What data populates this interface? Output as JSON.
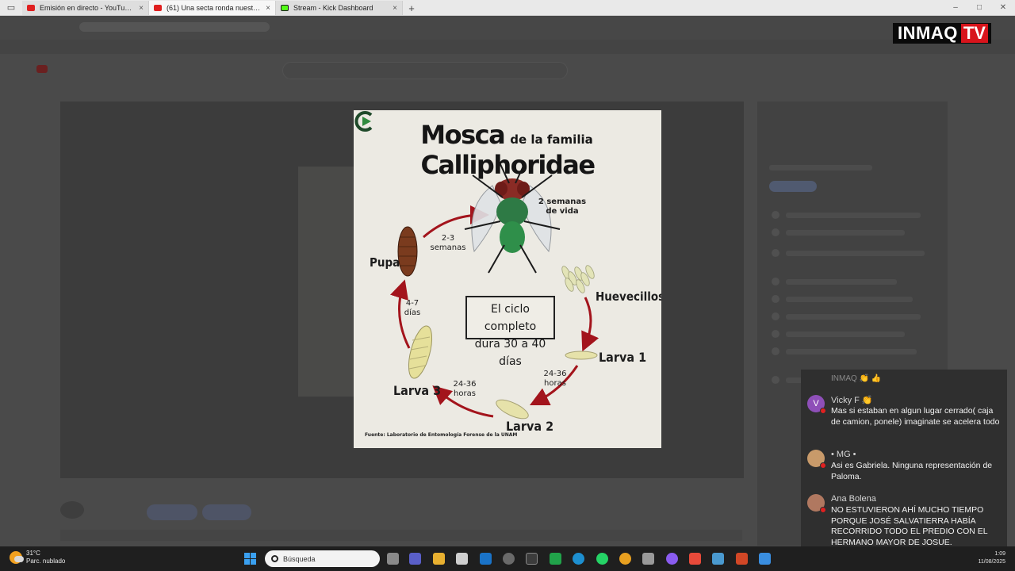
{
  "browser": {
    "tabs": [
      {
        "label": "Emisión en directo - YouTube Stu",
        "favicon": "youtube-icon",
        "active": false
      },
      {
        "label": "(61) Una secta ronda nuestra vida",
        "favicon": "youtube-icon",
        "active": true
      },
      {
        "label": "Stream - Kick Dashboard",
        "favicon": "kick-icon",
        "active": false
      }
    ],
    "new_tab": "+",
    "close_glyph": "×"
  },
  "brand": {
    "part1": "INMAQ",
    "part2": "TV",
    "accent": "#d8141c"
  },
  "infographic": {
    "title_big1": "Mosca",
    "title_small": "de la familia",
    "title_big2": "Calliphoridae",
    "stages": {
      "adult_duration_1": "2 semanas",
      "adult_duration_2": "de vida",
      "eggs": "Huevecillos",
      "larva1": "Larva 1",
      "larva1_to_2_1": "24-36",
      "larva1_to_2_2": "horas",
      "larva2": "Larva 2",
      "larva2_to_3_1": "24-36",
      "larva2_to_3_2": "horas",
      "larva3": "Larva 3",
      "larva3_to_pupa_1": "4-7",
      "larva3_to_pupa_2": "días",
      "pupa": "Pupa",
      "pupa_to_adult_1": "2-3",
      "pupa_to_adult_2": "semanas"
    },
    "cycle_box_1": "El ciclo completo",
    "cycle_box_2": "dura 30 a 40 días",
    "source": "Fuente: Laboratorio de Entomología Forense de la UNAM",
    "arrow_color": "#a3141c"
  },
  "chat": {
    "previous_line": "INMAQ 👏 👍",
    "messages": [
      {
        "author": "Vicky F 👏",
        "avatar_letter": "V",
        "avatar_color": "#8e4fb8",
        "text": "Mas si estaban en algun lugar cerrado( caja de camion, ponele) imaginate se acelera todo"
      },
      {
        "author": "• MG •",
        "avatar_letter": "",
        "avatar_color": "#c89a6a",
        "text": "Asi es Gabriela. Ninguna representación de Paloma."
      },
      {
        "author": "Ana Bolena",
        "avatar_letter": "",
        "avatar_color": "#b07860",
        "text": "NO ESTUVIERON AHÍ MUCHO TIEMPO PORQUE JOSÉ SALVATIERRA HABÍA RECORRIDO TODO EL PREDIO CON EL HERMANO MAYOR DE JOSUE."
      }
    ]
  },
  "taskbar": {
    "temperature": "31°C",
    "weather": "Parc. nublado",
    "search_placeholder": "Búsqueda",
    "time": "1:09",
    "date": "11/08/2025"
  }
}
